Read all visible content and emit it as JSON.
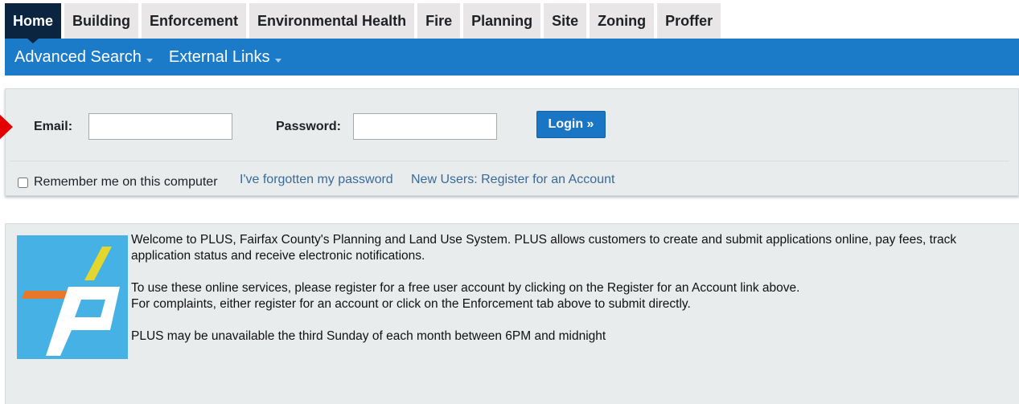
{
  "tabs": [
    {
      "label": "Home",
      "active": true
    },
    {
      "label": "Building"
    },
    {
      "label": "Enforcement"
    },
    {
      "label": "Environmental Health"
    },
    {
      "label": "Fire"
    },
    {
      "label": "Planning"
    },
    {
      "label": "Site"
    },
    {
      "label": "Zoning"
    },
    {
      "label": "Proffer"
    }
  ],
  "menu": {
    "advanced_search": "Advanced Search",
    "external_links": "External Links"
  },
  "login": {
    "email_label": "Email:",
    "email_value": "",
    "password_label": "Password:",
    "password_value": "",
    "login_button": "Login »",
    "remember_label": "Remember me on this computer",
    "remember_checked": false,
    "forgot_link": "I've forgotten my password",
    "register_link": "New Users: Register for an Account"
  },
  "info": {
    "paragraph1": "Welcome to PLUS, Fairfax County's Planning and Land Use System. PLUS allows customers to create and submit applications online, pay fees, track application status and receive electronic notifications.",
    "paragraph2_line1": "To use these online services, please register for a free user account by clicking on the Register for an Account link above.",
    "paragraph2_line2": "For complaints, either register for an account or click on the Enforcement tab above to submit directly.",
    "paragraph3": "PLUS may be unavailable the third Sunday of each month between 6PM and midnight"
  },
  "colors": {
    "active_tab": "#0b2440",
    "blue_bar": "#1b7bc9",
    "login_button": "#1a75c4",
    "arrow": "#e40000",
    "logo_background": "#45b1e4"
  }
}
